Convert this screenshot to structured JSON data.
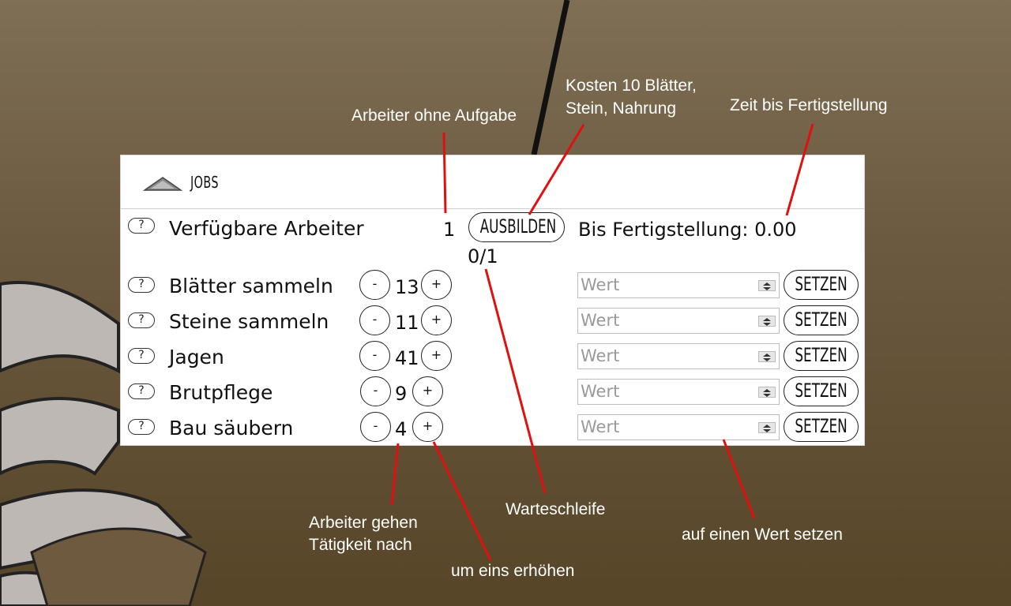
{
  "panel": {
    "title": "JOBS",
    "available": {
      "label": "Verfügbare Arbeiter",
      "count": "1",
      "train_button": "AUSBILDEN",
      "queue": "0/1",
      "completion": "Bis Fertigstellung: 0.00"
    },
    "help_symbol": "?",
    "minus": "-",
    "plus": "+",
    "set_button": "SETZEN",
    "input_placeholder": "Wert",
    "jobs": [
      {
        "label": "Blätter sammeln",
        "count": "13"
      },
      {
        "label": "Steine sammeln",
        "count": "11"
      },
      {
        "label": "Jagen",
        "count": "41"
      },
      {
        "label": "Brutpflege",
        "count": "9"
      },
      {
        "label": "Bau säubern",
        "count": "4"
      }
    ]
  },
  "annotations": {
    "idle_workers": "Arbeiter ohne Aufgabe",
    "cost_line1": "Kosten 10 Blätter,",
    "cost_line2": "Stein, Nahrung",
    "time": "Zeit bis Fertigstellung",
    "workers_line1": "Arbeiter gehen",
    "workers_line2": "Tätigkeit nach",
    "queue": "Warteschleife",
    "set_value": "auf einen Wert setzen",
    "increase": "um eins erhöhen"
  },
  "colors": {
    "annotation_line": "#e01010",
    "background_top": "#7f6f55",
    "background_bottom": "#574528"
  }
}
